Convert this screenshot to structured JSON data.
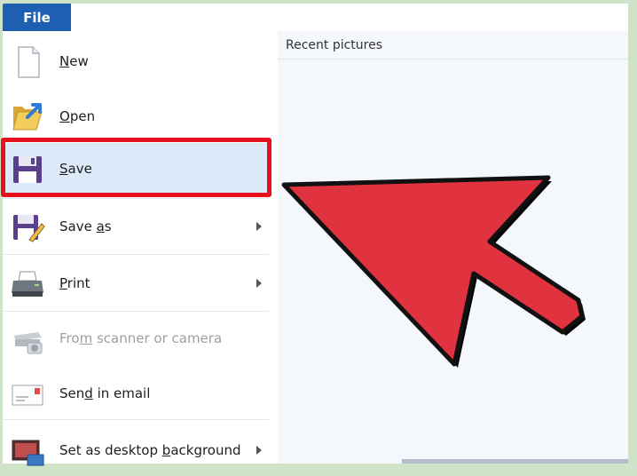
{
  "file_tab": "File",
  "recent": {
    "title": "Recent pictures"
  },
  "menu": {
    "items": [
      {
        "label": "New",
        "mnemonic": "N",
        "rest": "ew",
        "submenu": false,
        "disabled": false,
        "icon": "blank-page-icon"
      },
      {
        "label": "Open",
        "mnemonic": "O",
        "rest": "pen",
        "submenu": false,
        "disabled": false,
        "icon": "folder-open-icon"
      },
      {
        "label": "Save",
        "mnemonic": "S",
        "rest": "ave",
        "submenu": false,
        "disabled": false,
        "icon": "floppy-disk-icon",
        "selected": true
      },
      {
        "label": "Save as",
        "mnemonic": "a",
        "submenu": true,
        "disabled": false,
        "icon": "save-as-icon"
      },
      {
        "label": "Print",
        "mnemonic": "P",
        "rest": "rint",
        "submenu": true,
        "disabled": false,
        "icon": "printer-icon"
      },
      {
        "label": "From scanner or camera",
        "mnemonic": "m",
        "submenu": false,
        "disabled": true,
        "icon": "scanner-camera-icon"
      },
      {
        "label": "Send in email",
        "mnemonic": "d",
        "submenu": false,
        "disabled": false,
        "icon": "email-icon"
      },
      {
        "label": "Set as desktop background",
        "mnemonic": "b",
        "submenu": true,
        "disabled": false,
        "icon": "desktop-background-icon"
      }
    ]
  },
  "colors": {
    "file_tab_bg": "#1e5fb1",
    "highlight_border": "#e8101c",
    "arrow_fill": "#e0323f",
    "selected_bg": "#dce9f8"
  }
}
